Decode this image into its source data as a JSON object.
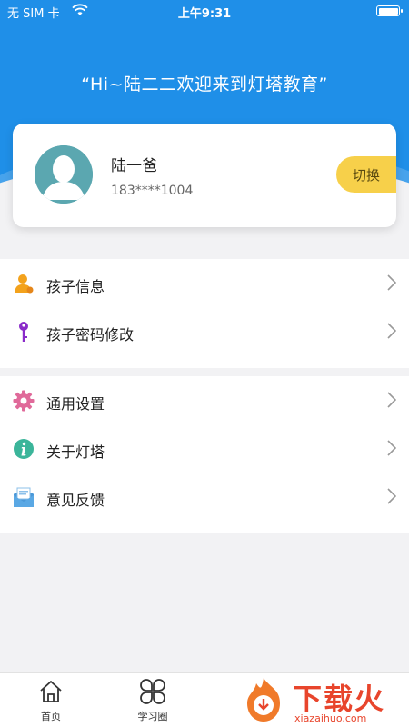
{
  "status_bar": {
    "carrier": "无 SIM 卡",
    "time": "上午9:31"
  },
  "header": {
    "welcome_text": "“Hi~陆二二欢迎来到灯塔教育”"
  },
  "profile": {
    "name": "陆一爸",
    "phone": "183****1004",
    "switch_label": "切换"
  },
  "menu": {
    "section1": [
      {
        "label": "孩子信息",
        "icon": "user-icon"
      },
      {
        "label": "孩子密码修改",
        "icon": "key-icon"
      }
    ],
    "section2": [
      {
        "label": "通用设置",
        "icon": "gear-icon"
      },
      {
        "label": "关于灯塔",
        "icon": "info-icon"
      },
      {
        "label": "意见反馈",
        "icon": "feedback-icon"
      }
    ]
  },
  "tabbar": {
    "home_label": "首页",
    "study_label": "学习圈"
  },
  "watermark": {
    "text": "下载火",
    "url": "xiazaihuo.com"
  },
  "colors": {
    "header_blue": "#1f8fe8",
    "switch_yellow": "#f7d04a",
    "watermark_red": "#e8452c"
  }
}
